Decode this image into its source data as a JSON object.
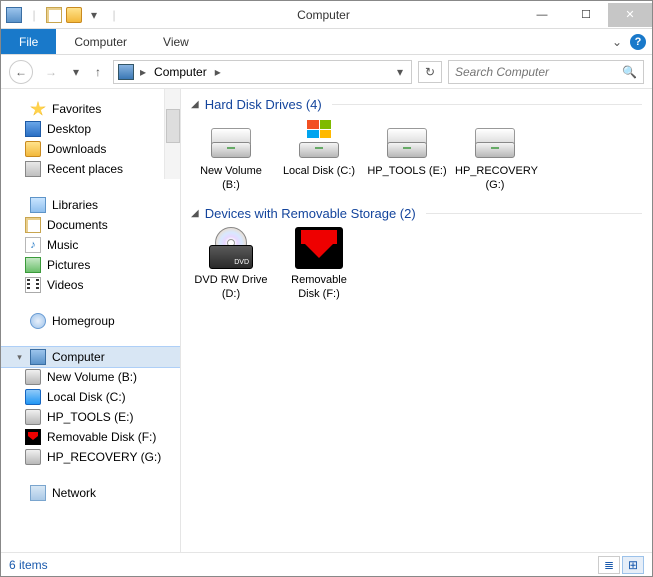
{
  "window": {
    "title": "Computer"
  },
  "ribbon": {
    "file": "File",
    "computer": "Computer",
    "view": "View"
  },
  "address": {
    "crumb": "Computer"
  },
  "search": {
    "placeholder": "Search Computer"
  },
  "sidebar": {
    "favorites": {
      "label": "Favorites",
      "items": [
        "Desktop",
        "Downloads",
        "Recent places"
      ]
    },
    "libraries": {
      "label": "Libraries",
      "items": [
        "Documents",
        "Music",
        "Pictures",
        "Videos"
      ]
    },
    "homegroup": {
      "label": "Homegroup"
    },
    "computer": {
      "label": "Computer",
      "items": [
        "New Volume (B:)",
        "Local Disk (C:)",
        "HP_TOOLS (E:)",
        "Removable Disk (F:)",
        "HP_RECOVERY (G:)"
      ]
    },
    "network": {
      "label": "Network"
    }
  },
  "categories": [
    {
      "label": "Hard Disk Drives (4)",
      "items": [
        {
          "name": "New Volume (B:)",
          "kind": "hdd"
        },
        {
          "name": "Local Disk (C:)",
          "kind": "hddwin"
        },
        {
          "name": "HP_TOOLS (E:)",
          "kind": "hdd"
        },
        {
          "name": "HP_RECOVERY (G:)",
          "kind": "hdd"
        }
      ]
    },
    {
      "label": "Devices with Removable Storage (2)",
      "items": [
        {
          "name": "DVD RW Drive (D:)",
          "kind": "dvd"
        },
        {
          "name": "Removable Disk (F:)",
          "kind": "removable"
        }
      ]
    }
  ],
  "status": {
    "text": "6 items"
  }
}
